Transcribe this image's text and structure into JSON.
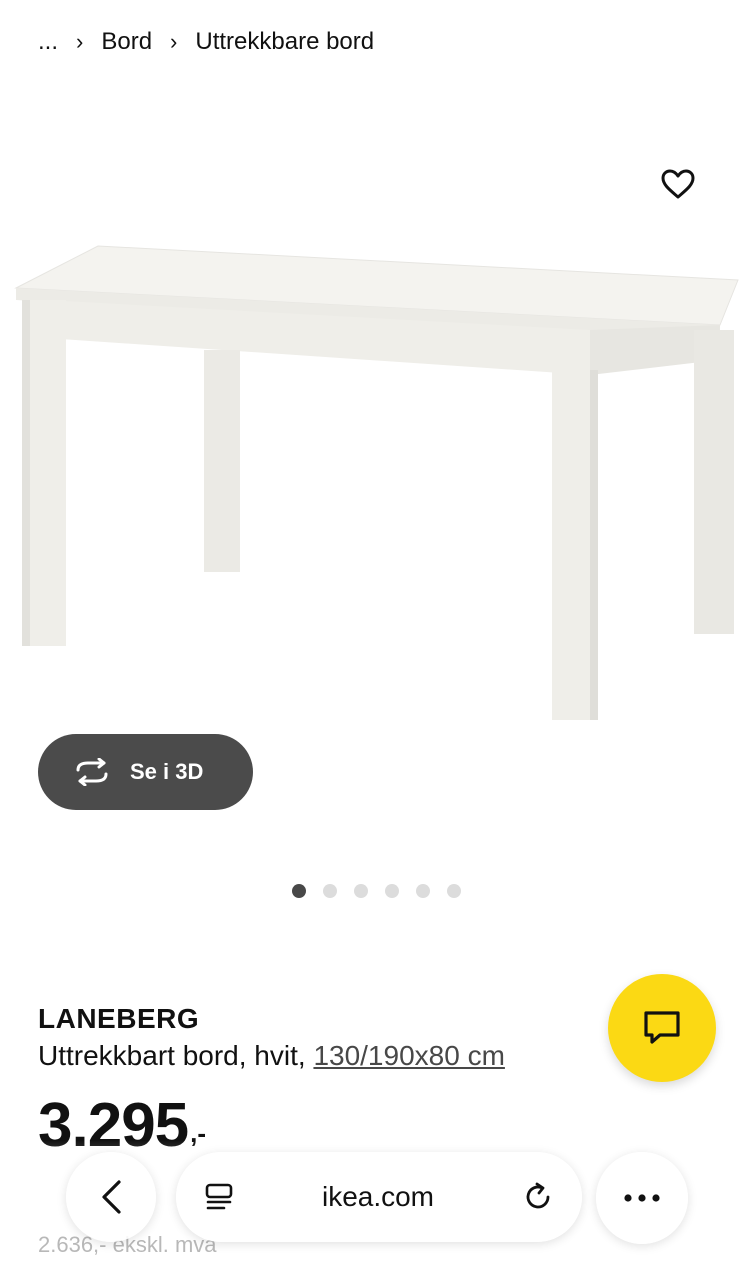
{
  "breadcrumb": {
    "items": [
      "...",
      "Bord",
      "Uttrekkbare bord"
    ]
  },
  "gallery": {
    "see_3d_label": "Se i 3D",
    "dot_count": 6,
    "active_index": 0
  },
  "product": {
    "name": "LANEBERG",
    "description": "Uttrekkbart bord, hvit,",
    "dimensions": "130/190x80 cm",
    "price_main": "3.295",
    "price_suffix": ",-",
    "price_ex_vat": "2.636,- ekskl. mva"
  },
  "browser": {
    "url": "ikea.com"
  },
  "colors": {
    "chat_fab": "#fbd914",
    "button_3d": "#4b4b4b",
    "dot_active": "#484848",
    "dot_inactive": "#dcdcdc"
  },
  "icons": {
    "favorite": "heart-icon",
    "chat": "chat-bubble-icon",
    "rotate3d": "rotate-3d-icon",
    "back": "chevron-left-icon",
    "tabs": "tabs-icon",
    "reload": "reload-icon",
    "more": "more-icon"
  }
}
